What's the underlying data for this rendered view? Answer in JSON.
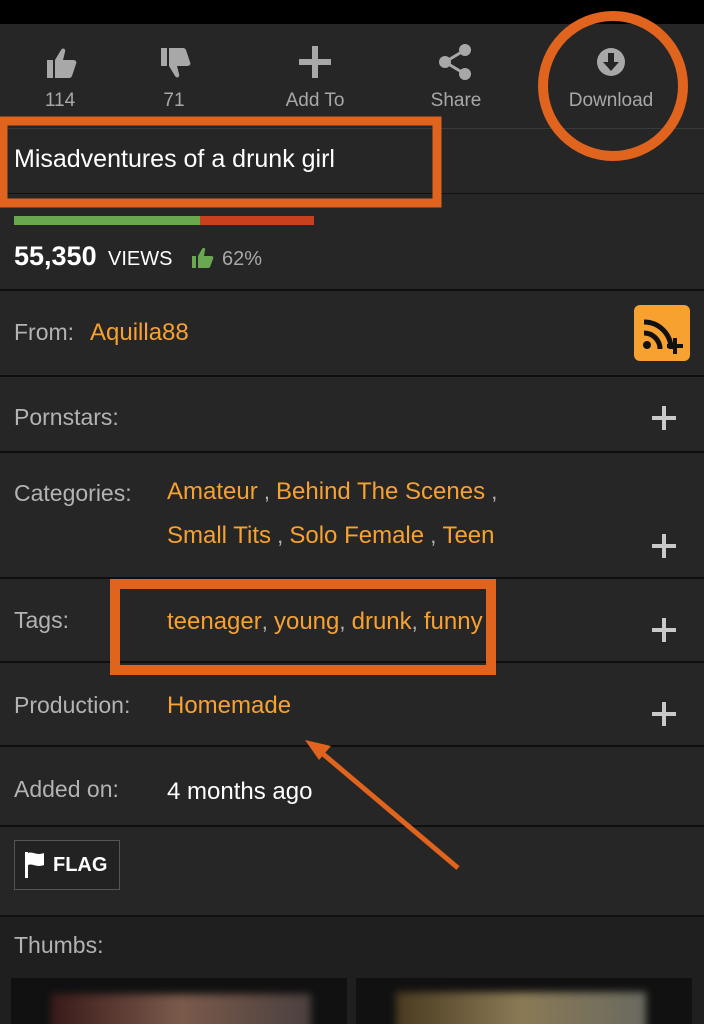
{
  "actions": {
    "likes": "114",
    "dislikes": "71",
    "add_to": "Add To",
    "share": "Share",
    "download": "Download"
  },
  "video": {
    "title": "Misadventures of a drunk girl",
    "views_count": "55,350",
    "views_word": "VIEWS",
    "rating_percent": "62%",
    "rating_fraction": 0.62
  },
  "details": {
    "from_label": "From:",
    "from_value": "Aquilla88",
    "pornstars_label": "Pornstars:",
    "categories_label": "Categories:",
    "categories": [
      "Amateur",
      "Behind The Scenes",
      "Small Tits",
      "Solo Female",
      "Teen"
    ],
    "tags_label": "Tags:",
    "tags": [
      "teenager",
      "young",
      "drunk",
      "funny"
    ],
    "production_label": "Production:",
    "production_value": "Homemade",
    "added_label": "Added on:",
    "added_value": "4 months ago"
  },
  "flag": {
    "label": "FLAG"
  },
  "thumbs": {
    "label": "Thumbs:"
  },
  "colors": {
    "background": "#1f1f1f",
    "accent_orange": "#f7a131",
    "annotation_orange": "#e0631e",
    "rating_green": "#6aa84f",
    "rating_red": "#c8401e"
  },
  "icons": {
    "like": "thumbs-up-icon",
    "dislike": "thumbs-down-icon",
    "add": "plus-icon",
    "share": "share-icon",
    "download": "download-icon",
    "rss": "rss-subscribe-icon",
    "flag": "flag-icon"
  }
}
